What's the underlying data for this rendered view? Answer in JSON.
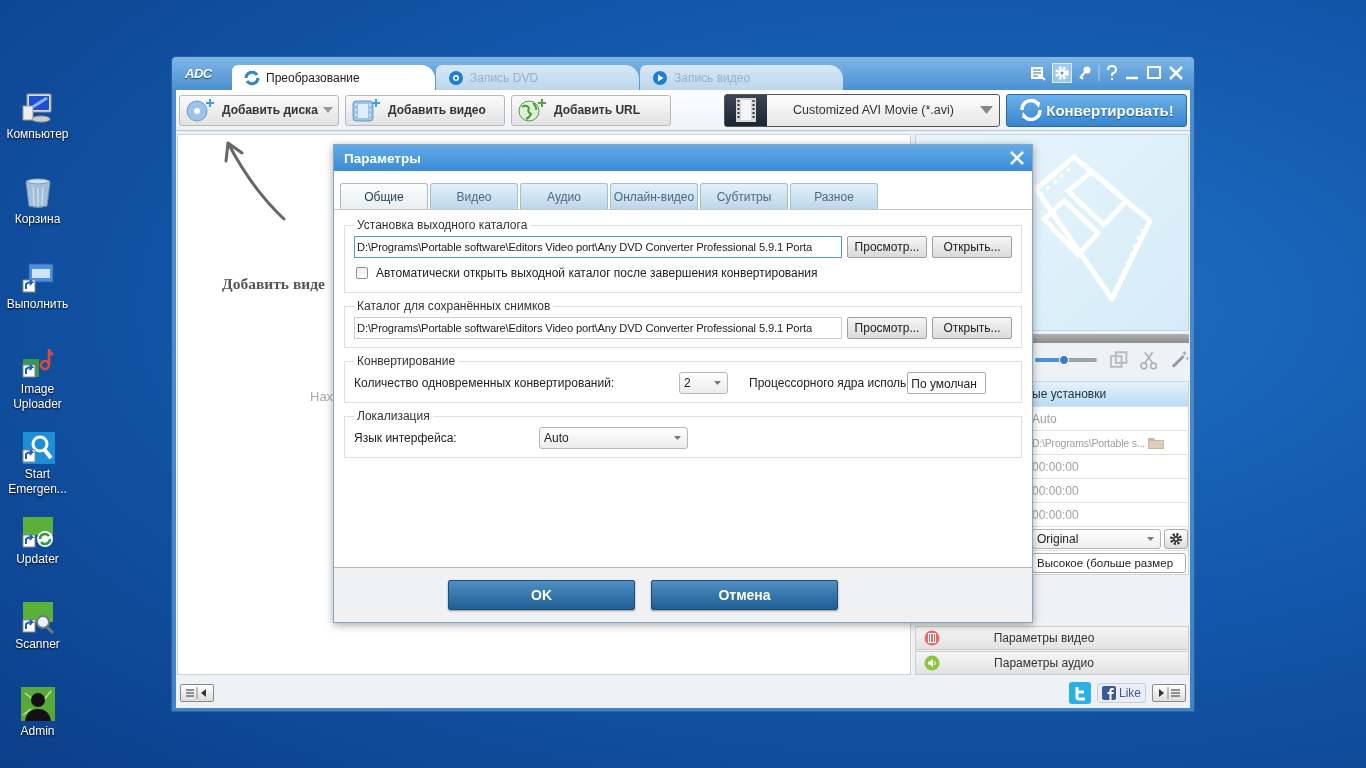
{
  "desktop_icons": [
    {
      "label": "Компьютер",
      "kind": "computer"
    },
    {
      "label": "Корзина",
      "kind": "trash"
    },
    {
      "label": "Выполнить",
      "kind": "run"
    },
    {
      "label": "Image Uploader",
      "kind": "uploader"
    },
    {
      "label": "Start Emergen...",
      "kind": "emergency"
    },
    {
      "label": "Updater",
      "kind": "updater"
    },
    {
      "label": "Scanner",
      "kind": "scanner"
    },
    {
      "label": "Admin",
      "kind": "user"
    }
  ],
  "app": {
    "logo": "ADC",
    "tabs": [
      {
        "label": "Преобразование",
        "selected": true,
        "kind": "convert"
      },
      {
        "label": "Запись DVD",
        "selected": false,
        "kind": "disc"
      },
      {
        "label": "Запись видео",
        "selected": false,
        "kind": "play"
      }
    ],
    "toolbar": {
      "buttons": [
        {
          "label": "Добавить диска",
          "kind": "disc",
          "dropdown": true
        },
        {
          "label": "Добавить видео",
          "kind": "film",
          "dropdown": false
        },
        {
          "label": "Добавить URL",
          "kind": "globe",
          "dropdown": false
        }
      ],
      "format": "Customized AVI Movie (*.avi)",
      "convert": "Конвертировать!"
    },
    "drop_area": {
      "title": "Добавить виде",
      "hint": "Нах"
    },
    "preview": {
      "progress": {
        "level": 0
      },
      "slider": {
        "level": 0.47
      }
    },
    "settings": {
      "header": "ые установки",
      "rows": [
        {
          "kind": "text",
          "value": "Auto"
        },
        {
          "kind": "path",
          "value": "D:\\Programs\\Portable s..."
        },
        {
          "kind": "text",
          "value": "00:00:00"
        },
        {
          "kind": "text",
          "value": "00:00:00"
        },
        {
          "kind": "text",
          "value": "00:00:00"
        },
        {
          "kind": "select",
          "value": "Original"
        },
        {
          "kind": "field",
          "value": "Высокое (больше размер"
        }
      ]
    },
    "panels": [
      {
        "label": "Параметры видео",
        "kind": "video"
      },
      {
        "label": "Параметры аудио",
        "kind": "audio"
      }
    ],
    "status_bar": {
      "like": "Like"
    }
  },
  "dialog": {
    "title": "Параметры",
    "tabs": [
      {
        "label": "Общие",
        "selected": true
      },
      {
        "label": "Видео",
        "selected": false
      },
      {
        "label": "Аудио",
        "selected": false
      },
      {
        "label": "Онлайн-видео",
        "selected": false
      },
      {
        "label": "Субтитры",
        "selected": false
      },
      {
        "label": "Разное",
        "selected": false
      }
    ],
    "groups": [
      {
        "kind": "folder",
        "legend": "Установка выходного каталога",
        "path": "D:\\Programs\\Portable software\\Editors Video port\\Any DVD Converter Professional 5.9.1 Porta",
        "focused": true,
        "browse": "Просмотр...",
        "open": "Открыть...",
        "checkbox": {
          "label": "Автоматически открыть выходной каталог после завершения конвертирования",
          "checked": false
        }
      },
      {
        "kind": "folder",
        "legend": "Каталог для сохранённых снимков",
        "path": "D:\\Programs\\Portable software\\Editors Video port\\Any DVD Converter Professional 5.9.1 Porta",
        "focused": false,
        "browse": "Просмотр...",
        "open": "Открыть..."
      },
      {
        "kind": "convert",
        "legend": "Конвертирование",
        "count_label": "Количество одновременных конвертирований:",
        "count": "2",
        "cores_label": "Процессорного ядра исполь",
        "cores": "По умолчан"
      },
      {
        "kind": "language",
        "legend": "Локализация",
        "label": "Язык интерфейса:",
        "value": "Auto"
      }
    ],
    "buttons": [
      "OK",
      "Отмена"
    ]
  }
}
